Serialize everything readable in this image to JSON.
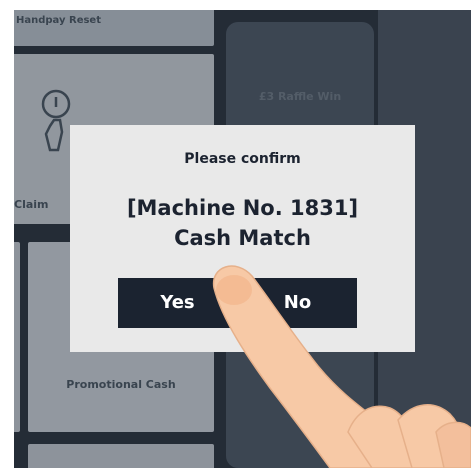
{
  "background": {
    "handpay_reset_label": "Handpay Reset",
    "claim_label": "Claim",
    "raffle_label": "£3 Raffle Win",
    "promotional_label": "Promotional Cash"
  },
  "dialog": {
    "title": "Please confirm",
    "message_line1": "[Machine No. 1831]",
    "message_line2": "Cash Match",
    "yes_label": "Yes",
    "no_label": "No"
  },
  "colors": {
    "dialog_background": "#e9e9e9",
    "button_background": "#1b2330",
    "button_text": "#ffffff",
    "screen_background": "#2b3440",
    "hand_skin": "#f7c9a6"
  },
  "icons": {
    "claim": "hand-coin-icon",
    "overlay": "pointing-finger"
  }
}
